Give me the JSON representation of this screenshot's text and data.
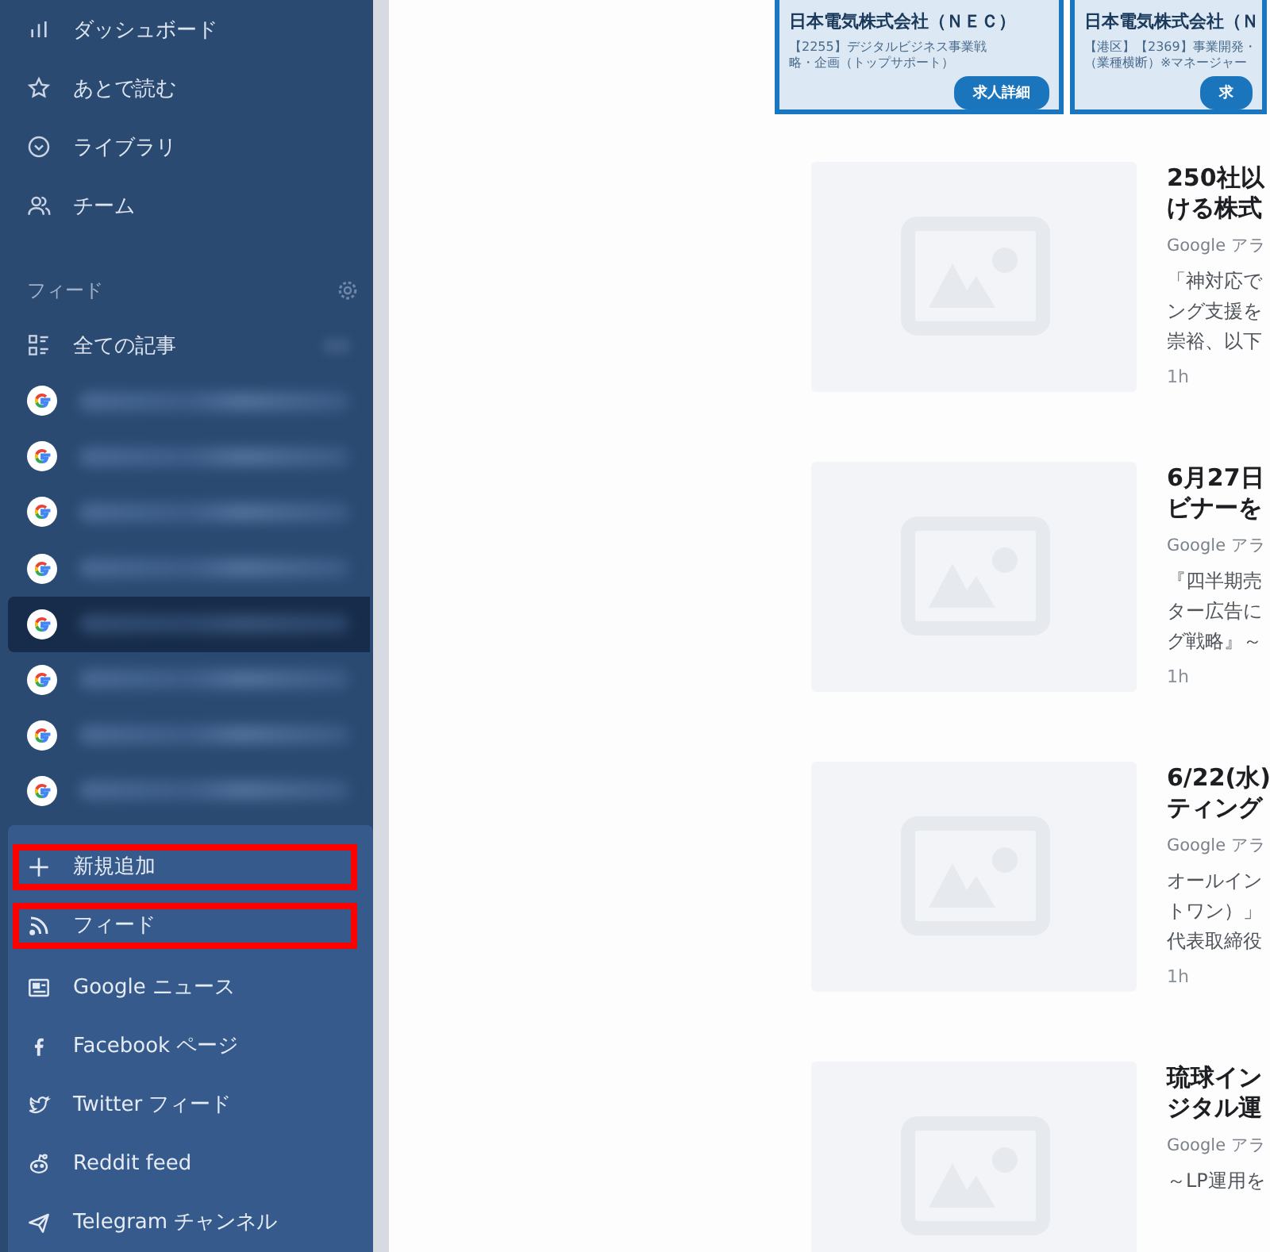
{
  "sidebar": {
    "nav": [
      {
        "label": "ダッシュボード"
      },
      {
        "label": "あとで読む"
      },
      {
        "label": "ライブラリ"
      },
      {
        "label": "チーム"
      }
    ],
    "feeds_header": "フィード",
    "all_articles": "全ての記事",
    "google_feeds": [
      {
        "selected": false
      },
      {
        "selected": false
      },
      {
        "selected": false
      },
      {
        "selected": false
      },
      {
        "selected": true
      },
      {
        "selected": false
      },
      {
        "selected": false
      },
      {
        "selected": false
      }
    ],
    "add_menu": [
      {
        "label": "新規追加",
        "highlighted": true
      },
      {
        "label": "フィード",
        "highlighted": true
      },
      {
        "label": "Google ニュース",
        "highlighted": false
      },
      {
        "label": "Facebook ページ",
        "highlighted": false
      },
      {
        "label": "Twitter フィード",
        "highlighted": false
      },
      {
        "label": "Reddit feed",
        "highlighted": false
      },
      {
        "label": "Telegram チャンネル",
        "highlighted": false
      }
    ]
  },
  "ads": [
    {
      "company": "日本電気株式会社（ＮＥＣ）",
      "description": [
        "【2255】デジタルビジネス事業戦",
        "略・企画（トップサポート）"
      ],
      "button": "求人詳細"
    },
    {
      "company": "日本電気株式会社（Ｎ",
      "description": [
        "【港区】【2369】事業開発・",
        "（業種横断）※マネージャー"
      ],
      "button": "求"
    }
  ],
  "articles": [
    {
      "title": [
        "250社以",
        "ける株式"
      ],
      "source": "Google アラ",
      "snippet": [
        "「神対応で",
        "ング支援を",
        "崇裕、以下"
      ],
      "time": "1h"
    },
    {
      "title": [
        "6月27日",
        "ビナーを"
      ],
      "source": "Google アラ",
      "snippet": [
        "『四半期売",
        "ター広告に",
        "グ戦略』～"
      ],
      "time": "1h"
    },
    {
      "title": [
        "6/22(水)",
        "ティング"
      ],
      "source": "Google アラ",
      "snippet": [
        "オールイン",
        "トワン）」",
        "代表取締役"
      ],
      "time": "1h"
    },
    {
      "title": [
        "琉球イン",
        "ジタル運"
      ],
      "source": "Google アラ",
      "snippet": [
        "～LP運用を"
      ]
    }
  ]
}
